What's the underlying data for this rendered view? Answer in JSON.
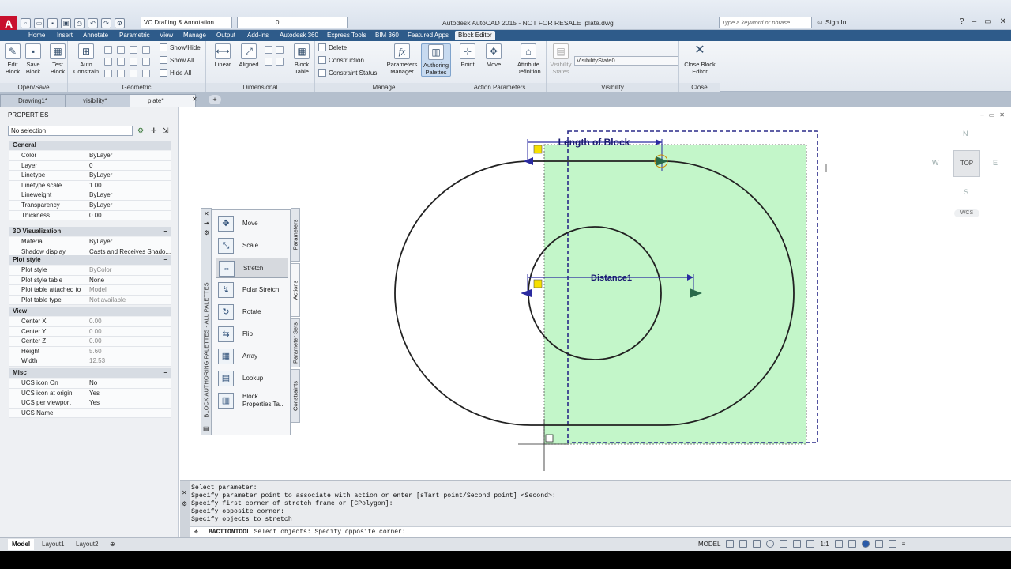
{
  "app": {
    "logo": "A",
    "workspace": "VC Drafting & Annotation",
    "layer": "0",
    "title": "Autodesk AutoCAD 2015 - NOT FOR RESALE",
    "file": "plate.dwg",
    "search_placeholder": "Type a keyword or phrase",
    "sign_in": "Sign In",
    "accent": "#2e5b8a"
  },
  "ribbon_tabs": [
    "Home",
    "Insert",
    "Annotate",
    "Parametric",
    "View",
    "Manage",
    "Output",
    "Add-ins",
    "Autodesk 360",
    "Express Tools",
    "BIM 360",
    "Featured Apps",
    "Block Editor"
  ],
  "ribbon": {
    "open_save": {
      "title": "Open/Save",
      "edit": "Edit Block",
      "save": "Save Block",
      "test": "Test Block"
    },
    "geometric": {
      "title": "Geometric",
      "auto": "Auto Constrain",
      "show_hide": "Show/Hide",
      "show_all": "Show All",
      "hide_all": "Hide All"
    },
    "dimensional": {
      "title": "Dimensional",
      "linear": "Linear",
      "aligned": "Aligned",
      "block_table": "Block Table"
    },
    "manage": {
      "title": "Manage",
      "delete": "Delete",
      "construction": "Construction",
      "constraint_status": "Constraint Status",
      "parameters_manager": "Parameters Manager",
      "authoring_palettes": "Authoring Palettes"
    },
    "action_parameters": {
      "title": "Action Parameters",
      "point": "Point",
      "move": "Move",
      "attribute_definition": "Attribute Definition"
    },
    "visibility": {
      "title": "Visibility",
      "visibility_states": "Visibility States",
      "state": "VisibilityState0"
    },
    "close": {
      "title": "Close",
      "close_block_editor": "Close Block Editor"
    }
  },
  "doc_tabs": [
    "Drawing1*",
    "visibility*",
    "plate*"
  ],
  "properties": {
    "header": "PROPERTIES",
    "selection": "No selection",
    "sections": [
      {
        "title": "General",
        "rows": [
          [
            "Color",
            "ByLayer"
          ],
          [
            "Layer",
            "0"
          ],
          [
            "Linetype",
            "ByLayer"
          ],
          [
            "Linetype scale",
            "1.00"
          ],
          [
            "Lineweight",
            "ByLayer"
          ],
          [
            "Transparency",
            "ByLayer"
          ],
          [
            "Thickness",
            "0.00"
          ]
        ]
      },
      {
        "title": "3D Visualization",
        "rows": [
          [
            "Material",
            "ByLayer"
          ],
          [
            "Shadow display",
            "Casts and Receives Shado..."
          ]
        ]
      },
      {
        "title": "Plot style",
        "rows": [
          [
            "Plot style",
            "ByColor"
          ],
          [
            "Plot style table",
            "None"
          ],
          [
            "Plot table attached to",
            "Model"
          ],
          [
            "Plot table type",
            "Not available"
          ]
        ]
      },
      {
        "title": "View",
        "rows": [
          [
            "Center X",
            "0.00"
          ],
          [
            "Center Y",
            "0.00"
          ],
          [
            "Center Z",
            "0.00"
          ],
          [
            "Height",
            "5.60"
          ],
          [
            "Width",
            "12.53"
          ]
        ]
      },
      {
        "title": "Misc",
        "rows": [
          [
            "UCS icon On",
            "No"
          ],
          [
            "UCS icon at origin",
            "Yes"
          ],
          [
            "UCS per viewport",
            "Yes"
          ],
          [
            "UCS Name",
            ""
          ]
        ]
      }
    ]
  },
  "palette": {
    "title": "BLOCK AUTHORING PALETTES - ALL PALETTES",
    "tabs": [
      "Parameters",
      "Actions",
      "Parameter Sets",
      "Constraints"
    ],
    "items": [
      "Move",
      "Scale",
      "Stretch",
      "Polar Stretch",
      "Rotate",
      "Flip",
      "Array",
      "Lookup",
      "Block Properties Ta..."
    ]
  },
  "drawing": {
    "param1": "Length of Block",
    "param2": "Distance1",
    "highlight_color": "#b8f5c0"
  },
  "viewcube": {
    "n": "N",
    "s": "S",
    "e": "E",
    "w": "W",
    "top": "TOP",
    "wcs": "WCS"
  },
  "command": {
    "history": [
      "Select parameter:",
      "Specify parameter point to associate with action or enter [sTart point/Second point] <Second>:",
      "Specify first corner of stretch frame or [CPolygon]:",
      "Specify opposite corner:",
      "Specify objects to stretch"
    ],
    "prompt_cmd": "BACTIONTOOL",
    "prompt_text": "Select objects: Specify opposite corner:"
  },
  "status": {
    "tabs": [
      "Model",
      "Layout1",
      "Layout2"
    ],
    "model": "MODEL",
    "scale": "1:1"
  }
}
